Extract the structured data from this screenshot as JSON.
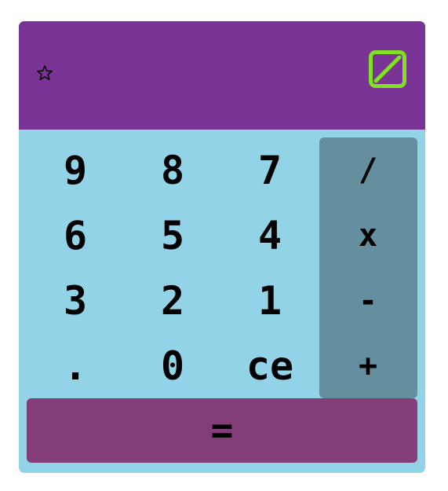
{
  "header": {
    "star_icon": "star-outline-icon",
    "toggle_icon": "square-slash-icon"
  },
  "keypad": {
    "digits": [
      {
        "label": "9"
      },
      {
        "label": "8"
      },
      {
        "label": "7"
      },
      {
        "label": "6"
      },
      {
        "label": "5"
      },
      {
        "label": "4"
      },
      {
        "label": "3"
      },
      {
        "label": "2"
      },
      {
        "label": "1"
      },
      {
        "label": "."
      },
      {
        "label": "0"
      },
      {
        "label": "ce"
      }
    ],
    "operators": [
      {
        "label": "/"
      },
      {
        "label": "x"
      },
      {
        "label": "-"
      },
      {
        "label": "+"
      }
    ],
    "equals_label": "="
  },
  "colors": {
    "header": "#783395",
    "body": "#93d3e8",
    "ops_panel": "#658f9f",
    "equals": "#833d78",
    "toggle_icon": "#7fe024"
  }
}
